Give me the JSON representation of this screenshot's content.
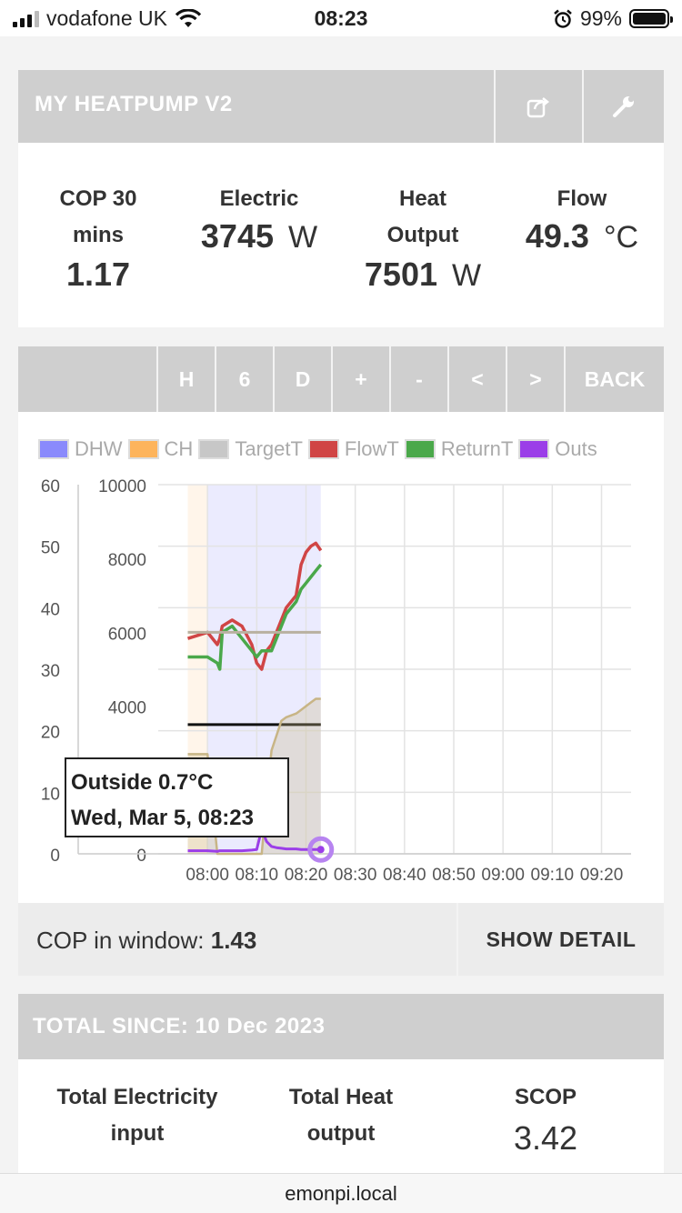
{
  "status_bar": {
    "carrier": "vodafone UK",
    "time": "08:23",
    "battery": "99%"
  },
  "header": {
    "title": "MY HEATPUMP V2"
  },
  "stats": {
    "cop_label": "COP 30 mins",
    "cop_value": "1.17",
    "electric_label": "Electric",
    "electric_value": "3745",
    "electric_unit": "W",
    "heat_label": "Heat Output",
    "heat_value": "7501",
    "heat_unit": "W",
    "flow_label": "Flow",
    "flow_value": "49.3",
    "flow_unit": "°C"
  },
  "nav": {
    "buttons": [
      "H",
      "6",
      "D",
      "+",
      "-",
      "<",
      ">",
      "BACK"
    ]
  },
  "chart_data": {
    "type": "line",
    "legend": [
      {
        "name": "DHW",
        "color": "#8a8afc"
      },
      {
        "name": "CH",
        "color": "#fdb45c"
      },
      {
        "name": "TargetT",
        "color": "#c7c7c7"
      },
      {
        "name": "FlowT",
        "color": "#d04545"
      },
      {
        "name": "ReturnT",
        "color": "#4aa84a"
      },
      {
        "name": "Outs",
        "color": "#9b3ee8"
      }
    ],
    "y_left_ticks": [
      "60",
      "50",
      "40",
      "30",
      "20",
      "10",
      "0"
    ],
    "y_right_ticks": [
      "10000",
      "8000",
      "6000",
      "4000",
      "0"
    ],
    "x_ticks": [
      "08:00",
      "08:10",
      "08:20",
      "08:30",
      "08:40",
      "08:50",
      "09:00",
      "09:10",
      "09:20"
    ],
    "ylim_left": [
      0,
      60
    ],
    "ylim_right": [
      0,
      10000
    ],
    "grid": true,
    "x_minutes": [
      -4,
      0,
      2,
      2.5,
      3,
      5,
      7,
      9,
      10,
      11,
      12,
      13,
      14,
      15,
      16,
      18,
      19,
      20,
      21,
      22,
      23
    ],
    "series": [
      {
        "name": "FlowT",
        "axis": "left",
        "values": [
          35,
          36,
          34,
          35,
          37,
          38,
          37,
          34,
          31,
          30,
          33,
          34,
          36,
          38,
          40,
          42,
          47,
          49,
          50,
          50.5,
          49.3
        ]
      },
      {
        "name": "ReturnT",
        "axis": "left",
        "values": [
          32,
          32,
          31,
          30,
          36,
          37,
          35,
          33,
          32,
          33,
          33,
          33,
          35,
          37,
          39,
          41,
          43,
          44,
          45,
          46,
          47
        ]
      },
      {
        "name": "TargetT",
        "axis": "left",
        "values": [
          36,
          36,
          36,
          36,
          36,
          36,
          36,
          36,
          36,
          36,
          36,
          36,
          36,
          36,
          36,
          36,
          36,
          36,
          36,
          36,
          36
        ]
      },
      {
        "name": "Electric",
        "axis": "right",
        "values": [
          3500,
          3500,
          3500,
          3500,
          3500,
          3500,
          3500,
          3500,
          3500,
          3500,
          3500,
          3500,
          3500,
          3500,
          3500,
          3500,
          3500,
          3500,
          3500,
          3500,
          3500
        ]
      },
      {
        "name": "Heat",
        "axis": "right",
        "values": [
          2700,
          2700,
          0,
          0,
          0,
          0,
          0,
          0,
          0,
          0,
          1500,
          2800,
          3200,
          3600,
          3700,
          3800,
          3900,
          4000,
          4100,
          4200,
          4200
        ]
      },
      {
        "name": "Outs",
        "axis": "left",
        "values": [
          0.5,
          0.5,
          0.4,
          0.5,
          0.5,
          0.5,
          0.5,
          0.6,
          0.7,
          4,
          2,
          1.2,
          1,
          0.9,
          0.8,
          0.8,
          0.7,
          0.7,
          0.7,
          0.7,
          0.7
        ]
      }
    ],
    "tooltip": {
      "line1": "Outside 0.7°C",
      "line2": "Wed, Mar 5, 08:23"
    }
  },
  "cop_window": {
    "label": "COP in window:",
    "value": "1.43",
    "detail_button": "SHOW DETAIL"
  },
  "totals": {
    "title": "TOTAL SINCE: 10 Dec 2023",
    "electricity_label": "Total Electricity input",
    "heat_label": "Total Heat output",
    "scop_label": "SCOP",
    "scop_value": "3.42"
  },
  "url": "emonpi.local"
}
